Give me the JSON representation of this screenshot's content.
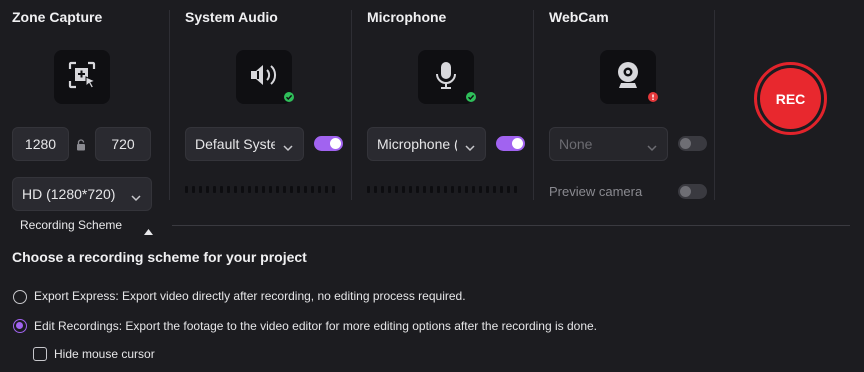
{
  "zone_capture": {
    "title": "Zone Capture",
    "icon": "region-select-icon",
    "width_value": "1280",
    "height_value": "720",
    "resolution_select": "HD (1280*720)",
    "recording_scheme_label": "Recording Scheme"
  },
  "system_audio": {
    "title": "System Audio",
    "icon": "speaker-icon",
    "status": "ok",
    "device_select": "Default System",
    "enabled": true
  },
  "microphone": {
    "title": "Microphone",
    "icon": "microphone-icon",
    "status": "ok",
    "device_select": "Microphone (",
    "enabled": true
  },
  "webcam": {
    "title": "WebCam",
    "icon": "webcam-icon",
    "status": "error",
    "device_select": "None",
    "enabled": false,
    "preview_label": "Preview camera",
    "preview_enabled": false
  },
  "record": {
    "label": "REC"
  },
  "scheme": {
    "heading": "Choose a recording scheme for your project",
    "options": [
      {
        "label": "Export Express: Export video directly after recording, no editing process required.",
        "checked": false
      },
      {
        "label": "Edit Recordings: Export the footage to the video editor for more editing options after the recording is done.",
        "checked": true
      }
    ],
    "hide_cursor_label": "Hide mouse cursor",
    "hide_cursor_checked": false
  },
  "colors": {
    "accent": "#a163f0",
    "record": "#e8282e",
    "ok": "#2fbf5a",
    "error": "#e5383b",
    "background": "#1c1c20"
  }
}
